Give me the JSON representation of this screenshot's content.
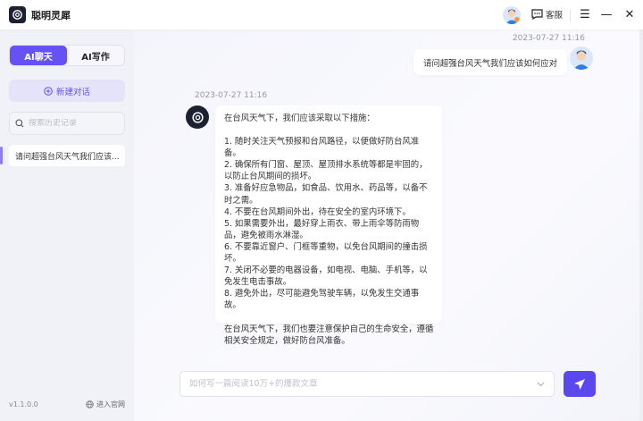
{
  "app": {
    "title": "聪明灵犀"
  },
  "header": {
    "customer_service": "客服"
  },
  "sidebar": {
    "tabs": [
      {
        "label": "AI聊天",
        "active": true
      },
      {
        "label": "AI写作",
        "active": false
      }
    ],
    "new_chat": "新建对话",
    "search_placeholder": "搜索历史记录",
    "history": [
      "请问超强台风天气我们应该..."
    ],
    "version": "v1.1.0.0",
    "website": "进入官网"
  },
  "chat": {
    "user_time": "2023-07-27 11:16",
    "user_message": "请问超强台风天气我们应该如何应对",
    "ai_time": "2023-07-27 11:16",
    "ai_intro": "在台风天气下，我们应该采取以下措施：",
    "ai_items": [
      "1. 随时关注天气预报和台风路径，以便做好防台风准备。",
      "2. 确保所有门窗、屋顶、屋顶排水系统等都是牢固的，以防止台风期间的损坏。",
      "3. 准备好应急物品，如食品、饮用水、药品等，以备不时之需。",
      "4. 不要在台风期间外出，待在安全的室内环境下。",
      "5. 如果需要外出，最好穿上雨衣、带上雨伞等防雨物品，避免被雨水淋湿。",
      "6. 不要靠近窗户、门框等重物，以免台风期间的撞击损坏。",
      "7. 关闭不必要的电器设备，如电视、电脑、手机等，以免发生电击事故。",
      "8. 避免外出，尽可能避免驾驶车辆，以免发生交通事故。"
    ],
    "ai_outro": "在台风天气下，我们也要注意保护自己的生命安全，遵循相关安全规定，做好防台风准备。"
  },
  "input": {
    "placeholder": "如何写一篇阅读10万+的爆款文章",
    "value": ""
  },
  "colors": {
    "accent": "#6552f5",
    "send": "#5a48ee"
  }
}
